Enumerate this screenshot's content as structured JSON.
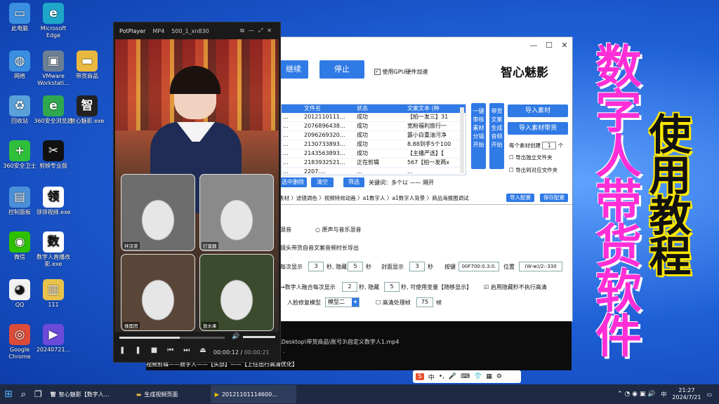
{
  "desktop": {
    "icons": [
      {
        "label": "此电脑",
        "icon": "computer-icon",
        "color": "#3b8fe0",
        "glyph": "▭"
      },
      {
        "label": "Microsoft Edge",
        "icon": "edge-icon",
        "color": "#1fa7c9",
        "glyph": "e"
      },
      {
        "label": "网络",
        "icon": "network-icon",
        "color": "#3b8fe0",
        "glyph": "◍"
      },
      {
        "label": "VMware Workstati...",
        "icon": "vmware-icon",
        "color": "#6b7f95",
        "glyph": "▣"
      },
      {
        "label": "带货商品",
        "icon": "folder-icon",
        "color": "#e9b840",
        "glyph": "▬"
      },
      {
        "label": "回收站",
        "icon": "recycle-bin-icon",
        "color": "#5aa0d8",
        "glyph": "♻"
      },
      {
        "label": "360安全浏览器",
        "icon": "browser-360-icon",
        "color": "#2fa84f",
        "glyph": "e"
      },
      {
        "label": "智心魅影.exe",
        "icon": "zhixin-app-icon",
        "color": "#222222",
        "glyph": "智"
      },
      {
        "label": "360安全卫士",
        "icon": "security-360-icon",
        "color": "#2fbf3a",
        "glyph": "+"
      },
      {
        "label": "剪映专业版",
        "icon": "capcut-icon",
        "color": "#111111",
        "glyph": "✂"
      },
      {
        "label": "控制面板",
        "icon": "control-panel-icon",
        "color": "#4a8fd8",
        "glyph": "▤"
      },
      {
        "label": "领领视频.exe",
        "icon": "ling-app-icon",
        "color": "#ffffff",
        "glyph": "领"
      },
      {
        "label": "微信",
        "icon": "wechat-icon",
        "color": "#2dc100",
        "glyph": "◉"
      },
      {
        "label": "数字人直播改影.exe",
        "icon": "shuzi-app-icon",
        "color": "#ffffff",
        "glyph": "数"
      },
      {
        "label": "QQ",
        "icon": "qq-icon",
        "color": "#f2f2f2",
        "glyph": "◕"
      },
      {
        "label": "111",
        "icon": "archive-icon",
        "color": "#e8c24a",
        "glyph": "▥"
      },
      {
        "label": "Google Chrome",
        "icon": "chrome-icon",
        "color": "#dd4b39",
        "glyph": "◎"
      },
      {
        "label": "20240721...",
        "icon": "video-file-icon",
        "color": "#6d4bd9",
        "glyph": "▶"
      }
    ]
  },
  "overlay": {
    "title_pink": "数字人带货软件",
    "title_black": "使用教程"
  },
  "app": {
    "brand": "智心魅影",
    "continue_label": "继续",
    "stop_label": "停止",
    "gpu_label": "使用GPU硬件加速",
    "table": {
      "columns": [
        "",
        "文件名",
        "状态",
        "文案文本 (种"
      ],
      "rows": [
        [
          "...",
          "2012110111...",
          "成功",
          "【拍一发三】31"
        ],
        [
          "...",
          "2076896438...",
          "成功",
          "宽粉福利旅行一"
        ],
        [
          "...",
          "2096269320...",
          "成功",
          "露小白重油污净"
        ],
        [
          "...",
          "2130733893...",
          "成功",
          "8.88到手5个100"
        ],
        [
          "...",
          "2143563893...",
          "成功",
          "【主播严选】【"
        ],
        [
          "...",
          "2183932521...",
          "正在剪辑",
          "567【拍一发两x"
        ],
        [
          "...",
          "2207....",
          "...",
          "..."
        ]
      ]
    },
    "side_btn1": "一键审核素材分镜开始",
    "side_btn2": "带货文案生成音频开始",
    "import_label": "导入素材",
    "import_goods_label": "导入素材带货",
    "per_group_label": "每个素材创建",
    "per_group_value": "1",
    "per_group_unit": "个",
    "export_single": "导出独立文件夹",
    "export_dir": "导出到对应文件夹",
    "delete_selected": "选中删除",
    "clear_label": "清空",
    "filter_label": "筛选",
    "keyword_label": "关键词：多个以 —— 隔开",
    "tabs": "素材 〉滤镜调色 〉视频特效动画 〉a1数字人 〉a1数字人背景 〉商品海报图调试",
    "import_config": "导入配置",
    "save_config": "保存配置",
    "mix_label1": "混音",
    "mix_label2": "原声与音乐混音",
    "export_text": "镜头带货自音文案音频时长导出",
    "row1": {
      "prefix": "每次显示",
      "v1": "3",
      "mid": "秒, 隐藏",
      "v2": "5",
      "s": "秒",
      "cover": "封面显示",
      "v3": "3",
      "s2": "秒",
      "kbd": "按键",
      "kbd_val": "00F700:0.3:0.",
      "pos": "位置",
      "pos_val": "(W-w)/2:-330"
    },
    "row2": {
      "prefix": "→数字人融合每次显示",
      "v1": "2",
      "mid": "秒, 隐藏",
      "v2": "5",
      "rest": "秒, 可使用变量【随移显示】",
      "hide_label": "启用隐藏秒不执行高清"
    },
    "row3": {
      "label": "人脸修复模型",
      "model": "模型二",
      "hd": "高清处理帧",
      "hd_val": "75",
      "hd_unit": "帧"
    },
    "terminal_line1": "\\Desktop\\带货商品\\账号3\\自定义数字人1.mp4",
    "terminal_line2": ". .",
    "terminal_line3": "视频剪辑——数字人——【头部】——【上任出行高清优化】"
  },
  "player": {
    "app_name": "PotPlayer",
    "format": "MP4",
    "file": "500_1_xn830",
    "thumbs": [
      "拌凉菜",
      "打蛋器",
      "揉面团",
      "放水果"
    ],
    "time_current": "00:00:12",
    "time_total": "00:00:21",
    "progress": 0.57
  },
  "ime": {
    "items": [
      "S",
      "中",
      "•,",
      "🎤",
      "⌨",
      "👕",
      "▦",
      "⚙"
    ]
  },
  "taskbar": {
    "items": [
      {
        "label": "智心魅影【数字人...",
        "icon": "zhixin-app-icon"
      },
      {
        "label": "生成视频页面",
        "icon": "folder-icon"
      },
      {
        "label": "20121101114600...",
        "icon": "potplayer-icon"
      }
    ],
    "time": "21:27",
    "date": "2024/7/21",
    "lang": "中"
  },
  "colors": {
    "accent": "#2f7ae5",
    "pink": "#ff2ed6",
    "yellow": "#ffe800"
  }
}
